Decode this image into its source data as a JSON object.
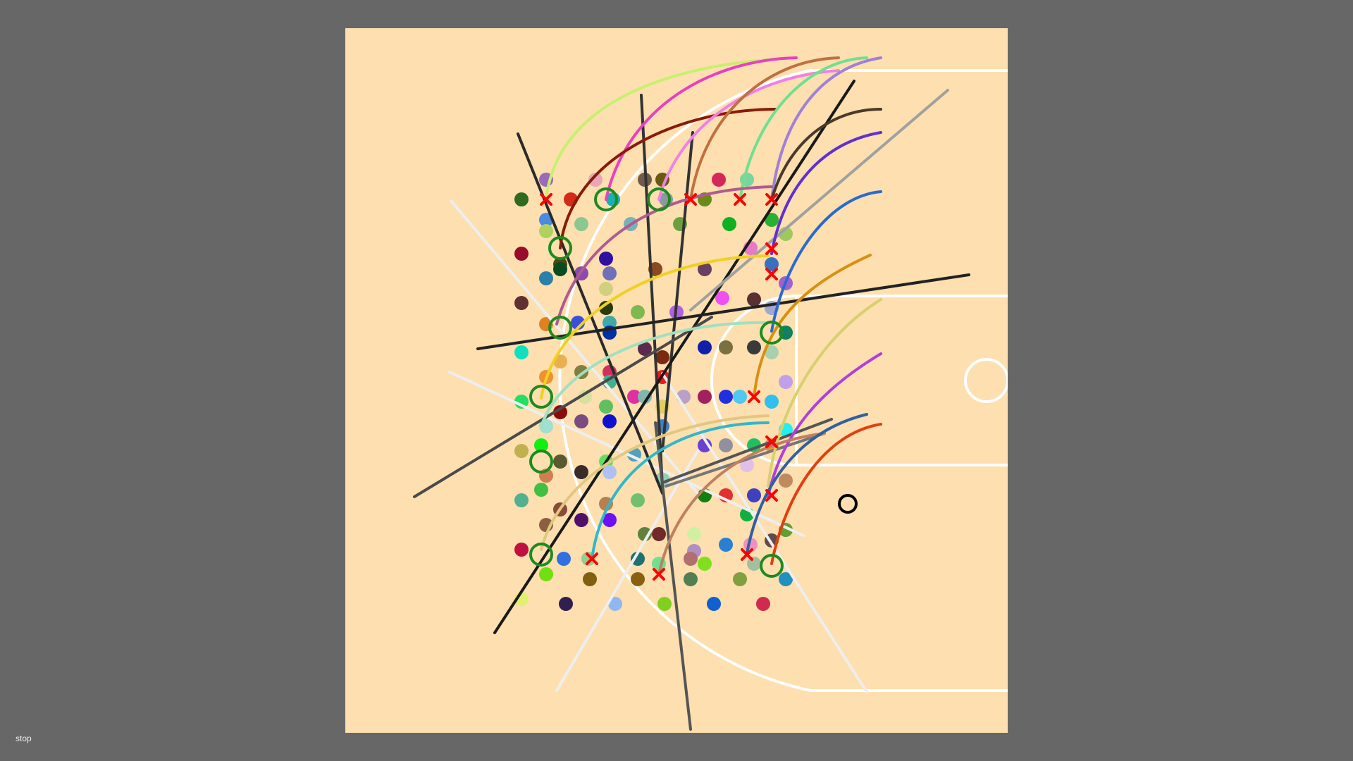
{
  "status": {
    "label": "stop"
  },
  "colors": {
    "background": "#676767",
    "court": "#fddfb0",
    "court_lines": "#ffffff",
    "hit_marker": "#ff0000",
    "circle_marker": "#1f8a1f",
    "target_marker": "#000000"
  },
  "icons": {
    "hit": "red-x-icon",
    "selected": "green-ring-icon",
    "target": "black-ring-icon"
  }
}
